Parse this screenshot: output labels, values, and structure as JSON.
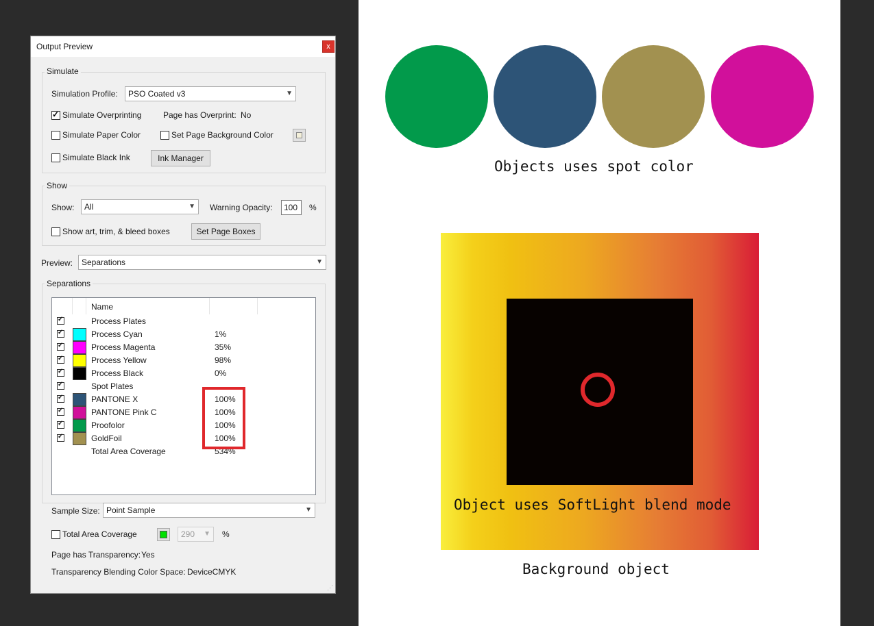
{
  "dialog": {
    "title": "Output Preview",
    "close_glyph": "x",
    "simulate": {
      "legend": "Simulate",
      "profile_label": "Simulation Profile:",
      "profile_value": "PSO Coated v3",
      "simulate_overprinting": "Simulate Overprinting",
      "simulate_overprinting_checked": true,
      "page_has_overprint_label": "Page has Overprint:",
      "page_has_overprint_value": "No",
      "simulate_paper_color": "Simulate Paper Color",
      "set_page_bg_color": "Set Page Background Color",
      "simulate_black_ink": "Simulate Black Ink",
      "ink_manager_button": "Ink Manager"
    },
    "show": {
      "legend": "Show",
      "show_label": "Show:",
      "show_value": "All",
      "warning_opacity_label": "Warning Opacity:",
      "warning_opacity_value": "100",
      "percent": "%",
      "show_boxes": "Show art, trim, & bleed boxes",
      "set_page_boxes_button": "Set Page Boxes"
    },
    "preview": {
      "label": "Preview:",
      "value": "Separations"
    },
    "separations": {
      "legend": "Separations",
      "column_name": "Name",
      "rows": [
        {
          "name": "Process Plates",
          "value": "",
          "swatch": "",
          "checked": true
        },
        {
          "name": "Process Cyan",
          "value": "1%",
          "swatch": "#00ffff",
          "checked": true
        },
        {
          "name": "Process Magenta",
          "value": "35%",
          "swatch": "#ff00ff",
          "checked": true
        },
        {
          "name": "Process Yellow",
          "value": "98%",
          "swatch": "#ffff00",
          "checked": true
        },
        {
          "name": "Process Black",
          "value": "0%",
          "swatch": "#000000",
          "checked": true
        },
        {
          "name": "Spot Plates",
          "value": "",
          "swatch": "",
          "checked": true
        },
        {
          "name": "PANTONE X",
          "value": "100%",
          "swatch": "#2d5477",
          "checked": true
        },
        {
          "name": "PANTONE Pink C",
          "value": "100%",
          "swatch": "#d1109b",
          "checked": true
        },
        {
          "name": "Proofolor",
          "value": "100%",
          "swatch": "#029a4b",
          "checked": true
        },
        {
          "name": "GoldFoil",
          "value": "100%",
          "swatch": "#a29150",
          "checked": true
        },
        {
          "name": "Total Area Coverage",
          "value": "534%",
          "swatch": "",
          "checked": false
        }
      ]
    },
    "sample_size": {
      "label": "Sample Size:",
      "value": "Point Sample"
    },
    "total_area_coverage": {
      "label": "Total Area Coverage",
      "value": "290",
      "percent": "%",
      "color": "#00e000"
    },
    "page_has_transparency": {
      "label": "Page has Transparency:",
      "value": "Yes"
    },
    "blending_space": {
      "label": "Transparency Blending Color Space:",
      "value": "DeviceCMYK"
    }
  },
  "artboard": {
    "spot_circle_colors": [
      "#029a4b",
      "#2d5477",
      "#a29150",
      "#d1109b"
    ],
    "spot_caption": "Objects uses spot color",
    "softlight_caption": "Object uses SoftLight blend mode",
    "background_caption": "Background object",
    "highlight_color": "#e0282c"
  }
}
